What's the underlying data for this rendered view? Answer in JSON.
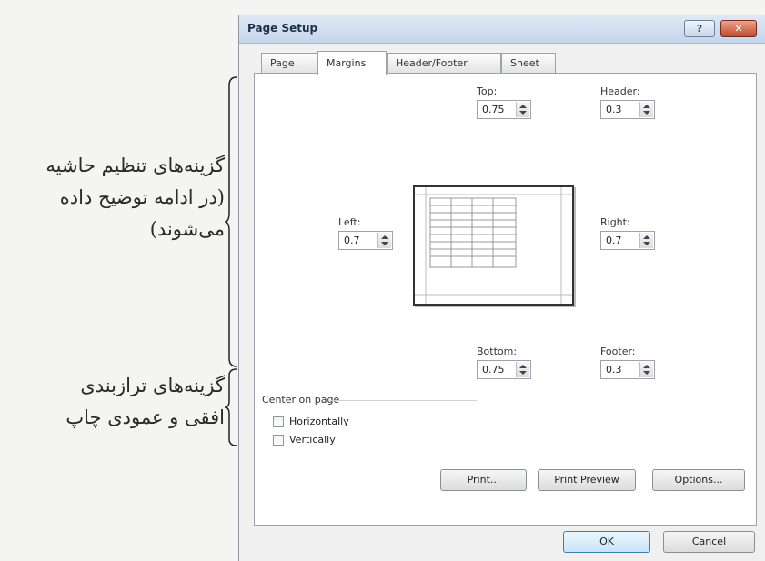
{
  "annotations": {
    "margin_options": [
      "گزینه‌های تنظیم حاشیه",
      "(در ادامه توضیح داده",
      "می‌شوند)"
    ],
    "centering_options": [
      "گزینه‌های ترازبندی",
      "افقی و عمودی چاپ"
    ]
  },
  "dialog": {
    "title": "Page Setup",
    "help_label": "?",
    "close_label": "✕",
    "tabs": [
      "Page",
      "Margins",
      "Header/Footer",
      "Sheet"
    ],
    "active_tab": "Margins",
    "margins": {
      "top": {
        "label": "Top:",
        "value": "0.75"
      },
      "header": {
        "label": "Header:",
        "value": "0.3"
      },
      "left": {
        "label": "Left:",
        "value": "0.7"
      },
      "right": {
        "label": "Right:",
        "value": "0.7"
      },
      "bottom": {
        "label": "Bottom:",
        "value": "0.75"
      },
      "footer": {
        "label": "Footer:",
        "value": "0.3"
      }
    },
    "center_on_page": {
      "title": "Center on page",
      "horizontally": {
        "label": "Horizontally",
        "checked": false
      },
      "vertically": {
        "label": "Vertically",
        "checked": false
      }
    },
    "buttons": {
      "print": "Print...",
      "print_preview": "Print Preview",
      "options": "Options...",
      "ok": "OK",
      "cancel": "Cancel"
    }
  }
}
